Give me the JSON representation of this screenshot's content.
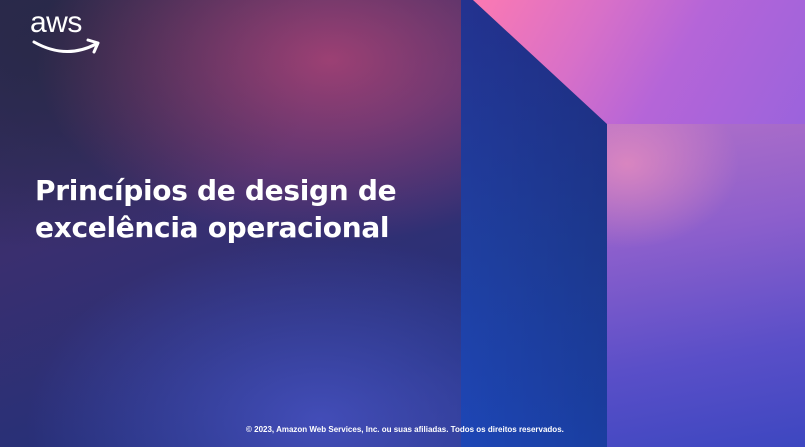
{
  "logo": {
    "text": "aws",
    "icon": "aws-smile-arrow-icon"
  },
  "title": {
    "line1": "Princípios de design de",
    "line2": "excelência operacional"
  },
  "footer": {
    "copyright": "© 2023, Amazon Web Services, Inc. ou suas afiliadas. Todos os direitos reservados."
  },
  "colors": {
    "text": "#ffffff",
    "panel_blue": "#1f3fa0",
    "panel_pink": "#ff7ab0",
    "panel_purple": "#8c5fcc"
  }
}
